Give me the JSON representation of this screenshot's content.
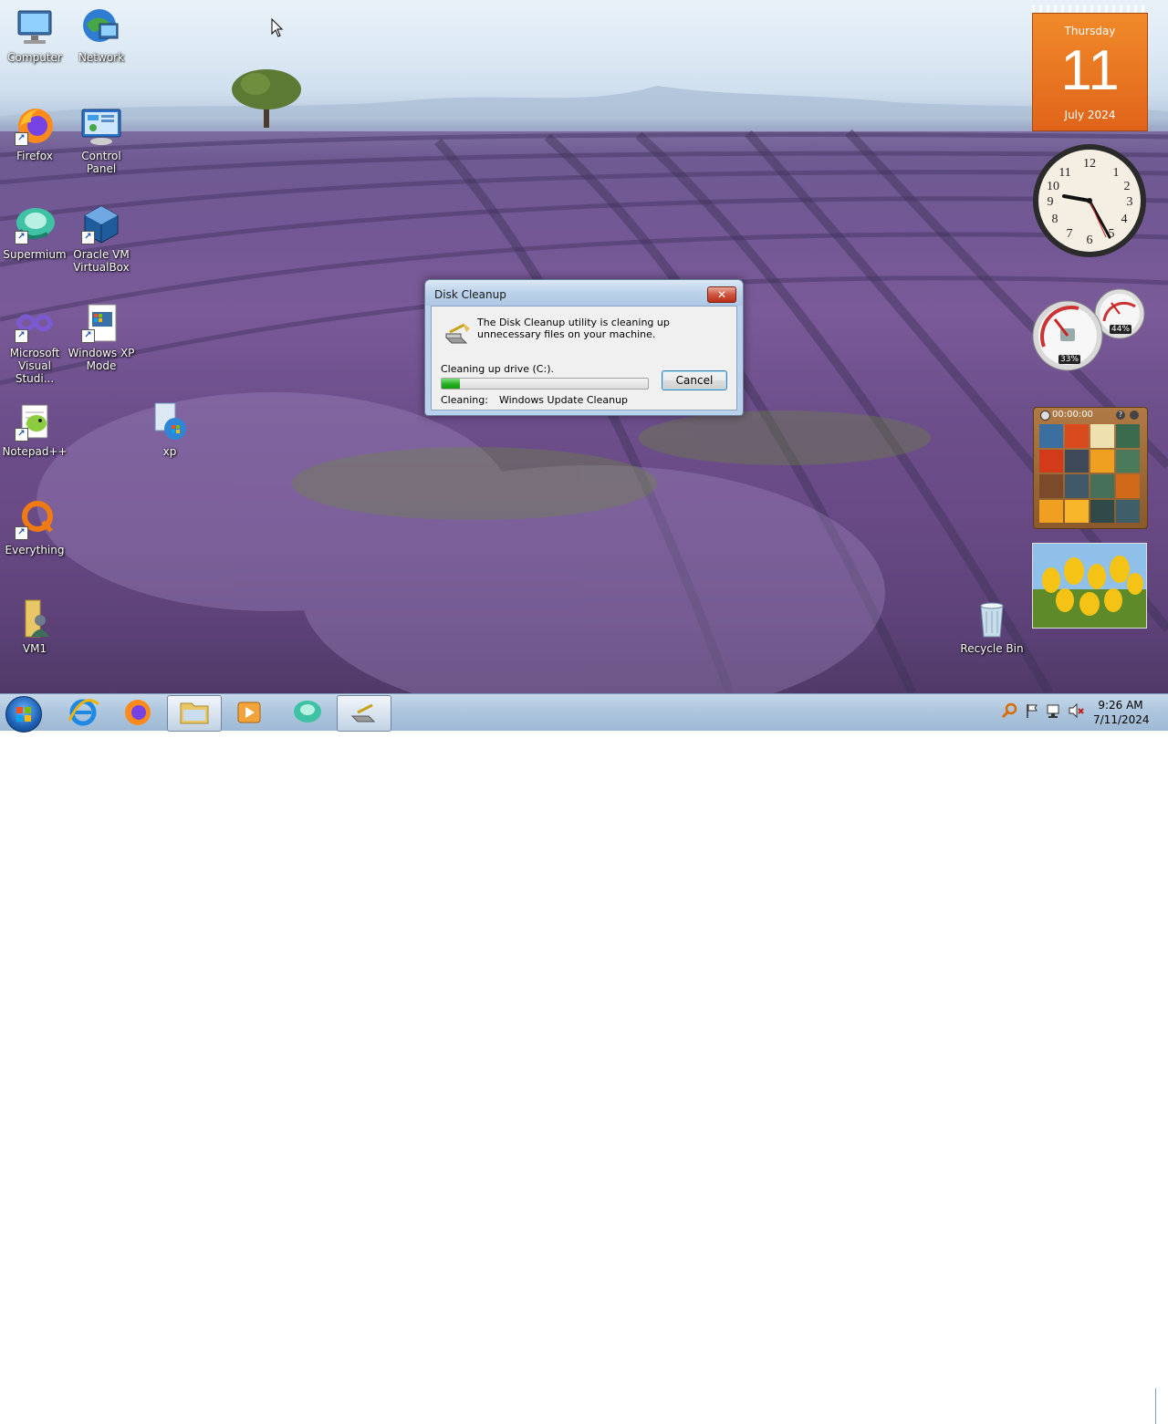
{
  "desktop_icons": {
    "computer": "Computer",
    "network": "Network",
    "firefox": "Firefox",
    "control_panel": "Control Panel",
    "supermium": "Supermium",
    "virtualbox": "Oracle VM VirtualBox",
    "visual_studio": "Microsoft Visual Studi...",
    "xp_mode": "Windows XP Mode",
    "notepadpp": "Notepad++",
    "xp": "xp",
    "everything": "Everything",
    "vm1": "VM1",
    "recycle_bin": "Recycle Bin"
  },
  "calendar_gadget": {
    "weekday": "Thursday",
    "day": "11",
    "month_year": "July 2024"
  },
  "cpu_gadget": {
    "cpu_label": "33%",
    "memory_label": "44%"
  },
  "puzzle_gadget": {
    "timer": "00:00:00"
  },
  "dialog": {
    "title": "Disk Cleanup",
    "close_label": "✕",
    "message": "The Disk Cleanup utility is cleaning up unnecessary files on your machine.",
    "drive_text": "Cleaning up drive  (C:).",
    "progress": 0.09,
    "cancel_label": "Cancel",
    "cleaning_label": "Cleaning:",
    "cleaning_item": "Windows Update Cleanup"
  },
  "taskbar": {
    "time": "9:26 AM",
    "date": "7/11/2024",
    "pinned": [
      "internet-explorer",
      "firefox",
      "file-explorer",
      "media-player",
      "supermium",
      "disk-cleanup"
    ]
  },
  "colors": {
    "calendar_orange": "#e8731f",
    "progress_green": "#26b022",
    "taskbar_blue": "#b0c8df"
  }
}
